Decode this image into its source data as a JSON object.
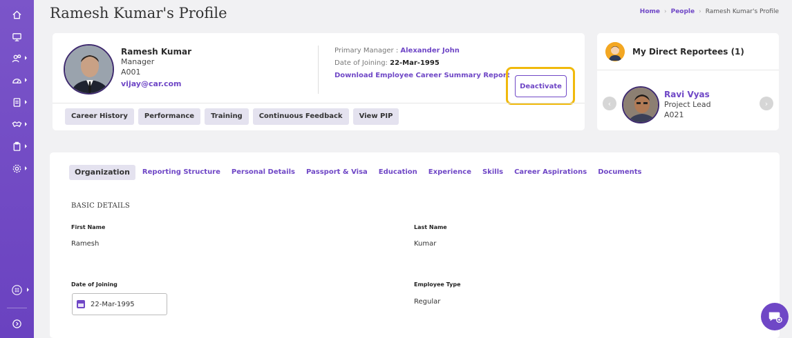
{
  "page": {
    "title": "Ramesh Kumar's Profile"
  },
  "breadcrumb": {
    "home": "Home",
    "people": "People",
    "current": "Ramesh Kumar's Profile"
  },
  "sidebar": {
    "items": [
      "home-icon",
      "monitor-icon",
      "people-icon",
      "gauge-icon",
      "document-icon",
      "handshake-icon",
      "clipboard-icon",
      "settings-icon"
    ],
    "bottom": [
      "apps-icon",
      "expand-icon"
    ]
  },
  "profile": {
    "name": "Ramesh Kumar",
    "role": "Manager",
    "code": "A001",
    "email": "vijay@car.com",
    "manager_label": "Primary Manager :",
    "manager_name": "Alexander John",
    "doj_label": "Date of Joining:",
    "doj_value": "22-Mar-1995",
    "download_link": "Download Employee Career Summary Report",
    "deactivate_label": "Deactivate",
    "tabs": [
      "Career History",
      "Performance",
      "Training",
      "Continuous Feedback",
      "View PIP"
    ]
  },
  "reportees": {
    "title": "My Direct Reportees (1)",
    "items": [
      {
        "name": "Ravi Vyas",
        "role": "Project Lead",
        "code": "A021"
      }
    ]
  },
  "details": {
    "tabs": [
      "Organization",
      "Reporting Structure",
      "Personal Details",
      "Passport & Visa",
      "Education",
      "Experience",
      "Skills",
      "Career Aspirations",
      "Documents"
    ],
    "section_title": "BASIC DETAILS",
    "first_name_label": "First Name",
    "first_name": "Ramesh",
    "last_name_label": "Last Name",
    "last_name": "Kumar",
    "doj_label": "Date of Joining",
    "doj_value": "22-Mar-1995",
    "emp_type_label": "Employee Type",
    "emp_type": "Regular"
  },
  "colors": {
    "accent": "#6f47c6",
    "highlight": "#f0b90b",
    "chip": "#e4e2ef"
  }
}
